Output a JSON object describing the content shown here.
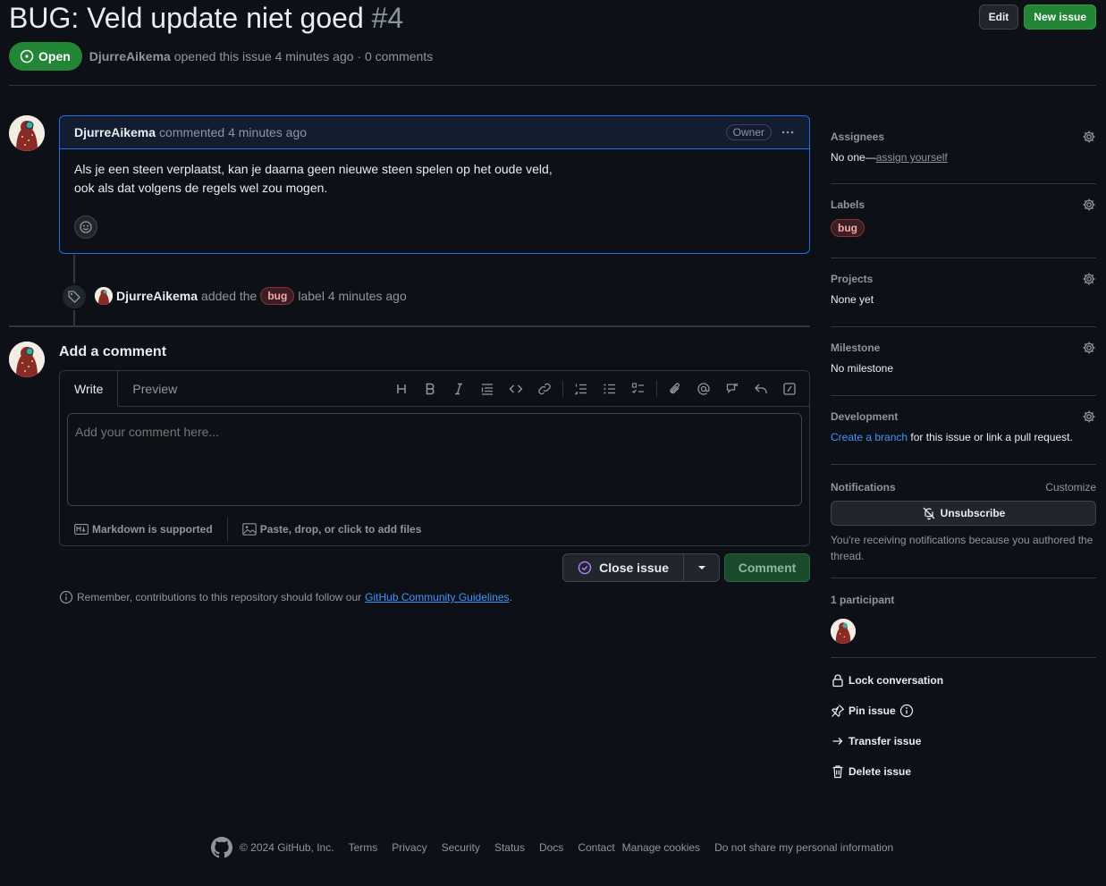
{
  "issue": {
    "title": "BUG: Veld update niet goed",
    "number": "#4",
    "state": "Open",
    "author": "DjurreAikema",
    "opened_meta": "opened this issue 4 minutes ago · 0 comments"
  },
  "header": {
    "edit_label": "Edit",
    "new_issue_label": "New issue"
  },
  "comment": {
    "author": "DjurreAikema",
    "timestamp": "commented 4 minutes ago",
    "role_badge": "Owner",
    "body_line1": "Als je een steen verplaatst, kan je daarna geen nieuwe steen spelen op het oude veld,",
    "body_line2": "ook als dat volgens de regels wel zou mogen."
  },
  "event": {
    "actor": "DjurreAikema",
    "action": "added the",
    "label": "bug",
    "suffix": "label 4 minutes ago"
  },
  "composer": {
    "title": "Add a comment",
    "tab_write": "Write",
    "tab_preview": "Preview",
    "placeholder": "Add your comment here...",
    "markdown_note": "Markdown is supported",
    "attach_note": "Paste, drop, or click to add files",
    "close_label": "Close issue",
    "comment_label": "Comment",
    "reminder_text": "Remember, contributions to this repository should follow our",
    "reminder_link": "GitHub Community Guidelines",
    "reminder_end": "."
  },
  "sidebar": {
    "assignees": {
      "heading": "Assignees",
      "value": "No one—",
      "link": "assign yourself"
    },
    "labels": {
      "heading": "Labels",
      "value": "bug"
    },
    "projects": {
      "heading": "Projects",
      "value": "None yet"
    },
    "milestone": {
      "heading": "Milestone",
      "value": "No milestone"
    },
    "development": {
      "heading": "Development",
      "link": "Create a branch",
      "value": " for this issue or link a pull request."
    },
    "notifications": {
      "heading": "Notifications",
      "customize": "Customize",
      "button": "Unsubscribe",
      "note": "You're receiving notifications because you authored the thread."
    },
    "participants": {
      "heading": "1 participant"
    },
    "actions": {
      "lock": "Lock conversation",
      "pin": "Pin issue",
      "transfer": "Transfer issue",
      "delete": "Delete issue"
    }
  },
  "footer": {
    "copyright": "© 2024 GitHub, Inc.",
    "links": [
      "Terms",
      "Privacy",
      "Security",
      "Status",
      "Docs",
      "Contact",
      "Manage cookies",
      "Do not share my personal information"
    ]
  },
  "colors": {
    "background": "#0d1117",
    "accent_green": "#238636",
    "link_blue": "#4493f8",
    "label_bug": "#f2a9ae",
    "focus_border": "#1f6feb"
  },
  "icons": [
    "issue-open-icon",
    "kebab-icon",
    "smiley-icon",
    "tag-icon",
    "heading-icon",
    "bold-icon",
    "italic-icon",
    "quote-icon",
    "code-icon",
    "link-icon",
    "ordered-list-icon",
    "unordered-list-icon",
    "task-list-icon",
    "paperclip-icon",
    "mention-icon",
    "cross-reference-icon",
    "reply-icon",
    "slash-command-icon",
    "markdown-icon",
    "image-icon",
    "check-circle-icon",
    "triangle-down-icon",
    "info-icon",
    "gear-icon",
    "bell-slash-icon",
    "lock-icon",
    "pin-icon",
    "arrow-right-icon",
    "trash-icon",
    "github-mark-icon"
  ]
}
